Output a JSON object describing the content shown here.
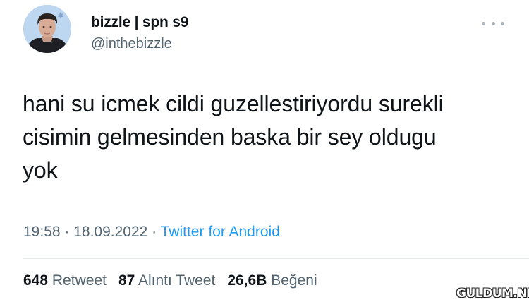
{
  "author": {
    "display_name": "bizzle | spn s9",
    "handle": "@inthebizzle"
  },
  "tweet": {
    "text_lines": [
      "hani su icmek cildi guzellestiriyordu surekli",
      "cisimin gelmesinden baska bir sey oldugu",
      "yok"
    ]
  },
  "meta": {
    "time": "19:58",
    "sep1": " · ",
    "date": "18.09.2022",
    "sep2": " · ",
    "source": "Twitter for Android"
  },
  "stats": [
    {
      "count": "648",
      "label": "Retweet"
    },
    {
      "count": "87",
      "label": "Alıntı Tweet"
    },
    {
      "count": "26,6B",
      "label": "Beğeni"
    }
  ],
  "watermark": "GULDUM.NET",
  "icons": {
    "more": "more-horizontal-icon"
  }
}
